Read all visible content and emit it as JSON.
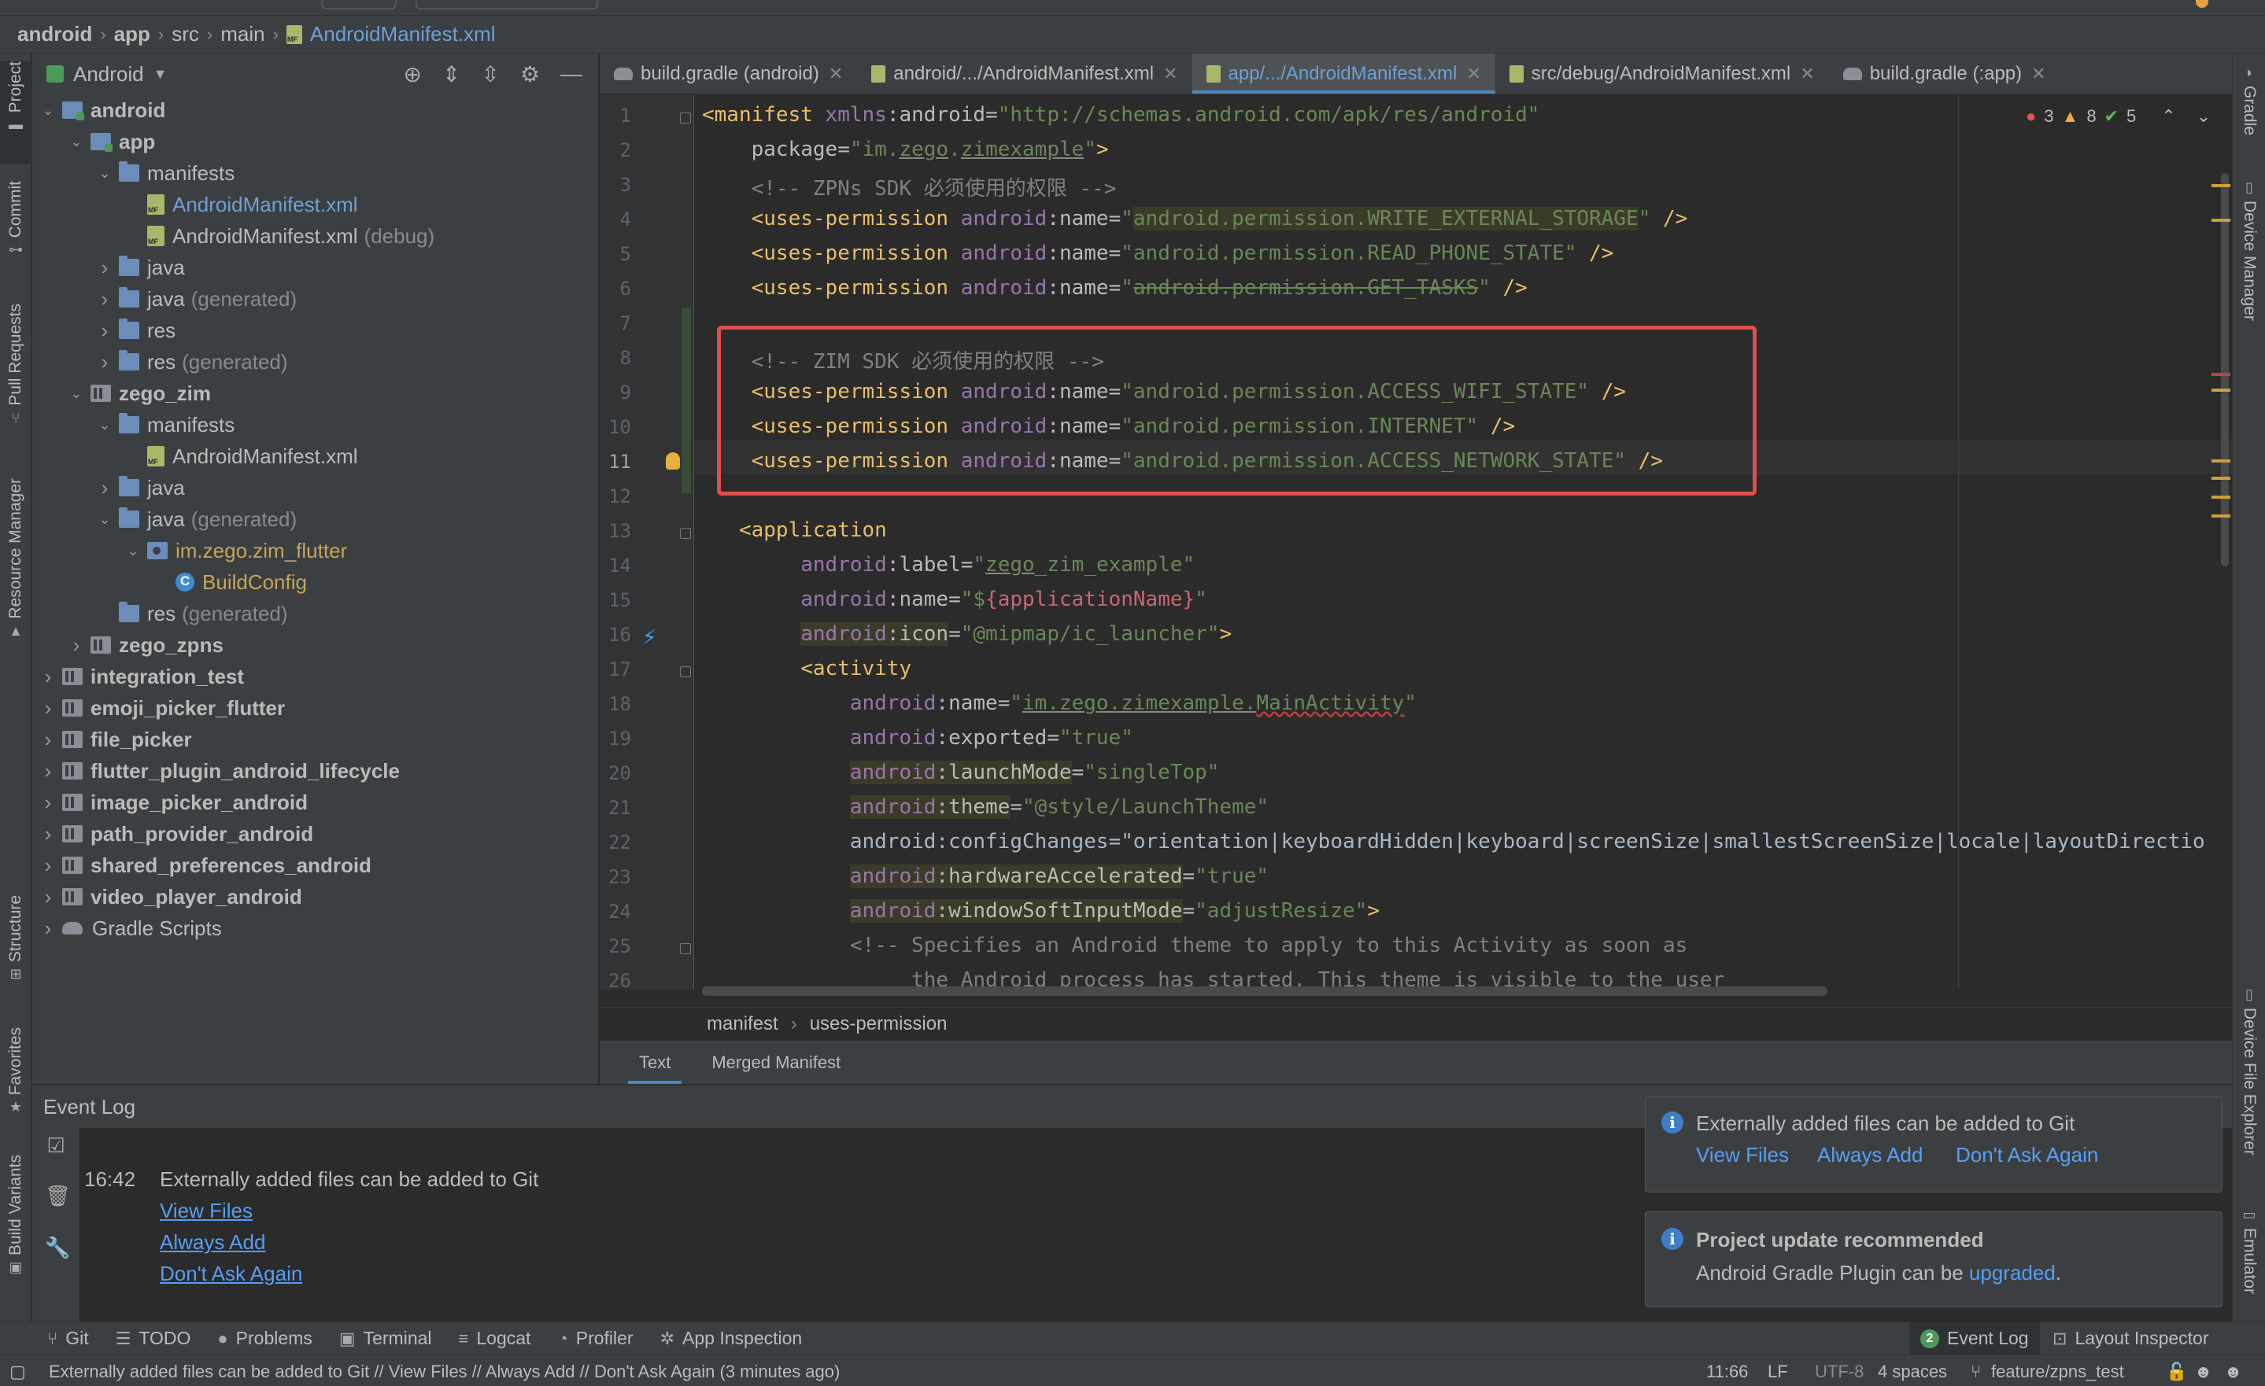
{
  "breadcrumb": [
    "android",
    "app",
    "src",
    "main",
    "AndroidManifest.xml"
  ],
  "project_panel": {
    "view_label": "Android",
    "tree": [
      {
        "label": "android",
        "suffix": "",
        "depth": 0,
        "icon": "module",
        "expanded": true,
        "bold": true
      },
      {
        "label": "app",
        "suffix": "",
        "depth": 1,
        "icon": "module",
        "expanded": true,
        "bold": true
      },
      {
        "label": "manifests",
        "suffix": "",
        "depth": 2,
        "icon": "folder",
        "expanded": true
      },
      {
        "label": "AndroidManifest.xml",
        "suffix": "",
        "depth": 3,
        "icon": "xml",
        "selected": true
      },
      {
        "label": "AndroidManifest.xml",
        "suffix": "(debug)",
        "depth": 3,
        "icon": "xml"
      },
      {
        "label": "java",
        "suffix": "",
        "depth": 2,
        "icon": "folder",
        "expanded": false
      },
      {
        "label": "java",
        "suffix": "(generated)",
        "depth": 2,
        "icon": "folder",
        "expanded": false
      },
      {
        "label": "res",
        "suffix": "",
        "depth": 2,
        "icon": "folder",
        "expanded": false
      },
      {
        "label": "res",
        "suffix": "(generated)",
        "depth": 2,
        "icon": "folder",
        "expanded": false
      },
      {
        "label": "zego_zim",
        "suffix": "",
        "depth": 1,
        "icon": "library",
        "expanded": true,
        "bold": true
      },
      {
        "label": "manifests",
        "suffix": "",
        "depth": 2,
        "icon": "folder",
        "expanded": true
      },
      {
        "label": "AndroidManifest.xml",
        "suffix": "",
        "depth": 3,
        "icon": "xml"
      },
      {
        "label": "java",
        "suffix": "",
        "depth": 2,
        "icon": "folder",
        "expanded": false
      },
      {
        "label": "java",
        "suffix": "(generated)",
        "depth": 2,
        "icon": "folder",
        "expanded": true
      },
      {
        "label": "im.zego.zim_flutter",
        "suffix": "",
        "depth": 3,
        "icon": "package",
        "expanded": true,
        "pkg": true
      },
      {
        "label": "BuildConfig",
        "suffix": "",
        "depth": 4,
        "icon": "class",
        "pkg": true
      },
      {
        "label": "res",
        "suffix": "(generated)",
        "depth": 2,
        "icon": "folder"
      },
      {
        "label": "zego_zpns",
        "suffix": "",
        "depth": 1,
        "icon": "library",
        "expanded": false,
        "bold": true
      },
      {
        "label": "integration_test",
        "suffix": "",
        "depth": 0,
        "icon": "library",
        "expanded": false,
        "bold": true
      },
      {
        "label": "emoji_picker_flutter",
        "suffix": "",
        "depth": 0,
        "icon": "library",
        "expanded": false,
        "bold": true
      },
      {
        "label": "file_picker",
        "suffix": "",
        "depth": 0,
        "icon": "library",
        "expanded": false,
        "bold": true
      },
      {
        "label": "flutter_plugin_android_lifecycle",
        "suffix": "",
        "depth": 0,
        "icon": "library",
        "expanded": false,
        "bold": true
      },
      {
        "label": "image_picker_android",
        "suffix": "",
        "depth": 0,
        "icon": "library",
        "expanded": false,
        "bold": true
      },
      {
        "label": "path_provider_android",
        "suffix": "",
        "depth": 0,
        "icon": "library",
        "expanded": false,
        "bold": true
      },
      {
        "label": "shared_preferences_android",
        "suffix": "",
        "depth": 0,
        "icon": "library",
        "expanded": false,
        "bold": true
      },
      {
        "label": "video_player_android",
        "suffix": "",
        "depth": 0,
        "icon": "library",
        "expanded": false,
        "bold": true
      },
      {
        "label": "Gradle Scripts",
        "suffix": "",
        "depth": 0,
        "icon": "gradle",
        "expanded": false
      }
    ]
  },
  "editor_tabs": [
    {
      "label": "build.gradle (android)",
      "icon": "gradle",
      "active": false
    },
    {
      "label": "android/.../AndroidManifest.xml",
      "icon": "xml",
      "active": false
    },
    {
      "label": "app/.../AndroidManifest.xml",
      "icon": "xml",
      "active": true
    },
    {
      "label": "src/debug/AndroidManifest.xml",
      "icon": "xml",
      "active": false
    },
    {
      "label": "build.gradle (:app)",
      "icon": "gradle",
      "active": false
    }
  ],
  "inspections": {
    "errors": "3",
    "warnings": "8",
    "ok": "5"
  },
  "code_lines": [
    [
      "1",
      "<manifest xmlns:android=\"http://schemas.android.com/apk/res/android\""
    ],
    [
      "2",
      "    package=\"im.zego.zimexample\">"
    ],
    [
      "3",
      "    <!-- ZPNs SDK 必须使用的权限 -->"
    ],
    [
      "4",
      "    <uses-permission android:name=\"android.permission.WRITE_EXTERNAL_STORAGE\" />"
    ],
    [
      "5",
      "    <uses-permission android:name=\"android.permission.READ_PHONE_STATE\" />"
    ],
    [
      "6",
      "    <uses-permission android:name=\"android.permission.GET_TASKS\" />"
    ],
    [
      "7",
      ""
    ],
    [
      "8",
      "    <!-- ZIM SDK 必须使用的权限 -->"
    ],
    [
      "9",
      "    <uses-permission android:name=\"android.permission.ACCESS_WIFI_STATE\" />"
    ],
    [
      "10",
      "    <uses-permission android:name=\"android.permission.INTERNET\" />"
    ],
    [
      "11",
      "    <uses-permission android:name=\"android.permission.ACCESS_NETWORK_STATE\" />"
    ],
    [
      "12",
      ""
    ],
    [
      "13",
      "   <application"
    ],
    [
      "14",
      "        android:label=\"zego_zim_example\""
    ],
    [
      "15",
      "        android:name=\"${applicationName}\""
    ],
    [
      "16",
      "        android:icon=\"@mipmap/ic_launcher\">"
    ],
    [
      "17",
      "        <activity"
    ],
    [
      "18",
      "            android:name=\"im.zego.zimexample.MainActivity\""
    ],
    [
      "19",
      "            android:exported=\"true\""
    ],
    [
      "20",
      "            android:launchMode=\"singleTop\""
    ],
    [
      "21",
      "            android:theme=\"@style/LaunchTheme\""
    ],
    [
      "22",
      "            android:configChanges=\"orientation|keyboardHidden|keyboard|screenSize|smallestScreenSize|locale|layoutDirectio"
    ],
    [
      "23",
      "            android:hardwareAccelerated=\"true\""
    ],
    [
      "24",
      "            android:windowSoftInputMode=\"adjustResize\">"
    ],
    [
      "25",
      "            <!-- Specifies an Android theme to apply to this Activity as soon as"
    ],
    [
      "26",
      "                 the Android process has started. This theme is visible to the user"
    ]
  ],
  "editor_breadcrumb": [
    "manifest",
    "uses-permission"
  ],
  "editor_bottom_tabs": [
    "Text",
    "Merged Manifest"
  ],
  "event_log": {
    "title": "Event Log",
    "time": "16:42",
    "message": "Externally added files can be added to Git",
    "links": [
      "View Files",
      "Always Add",
      "Don't Ask Again"
    ]
  },
  "notifications": [
    {
      "title": "Externally added files can be added to Git",
      "links": [
        "View Files",
        "Always Add",
        "Don't Ask Again"
      ]
    },
    {
      "title": "Project update recommended",
      "body": "Android Gradle Plugin can be",
      "link": "upgraded",
      "tail": "."
    }
  ],
  "left_stripe": [
    "Project",
    "Commit",
    "Pull Requests",
    "Resource Manager",
    "Structure",
    "Favorites",
    "Build Variants"
  ],
  "right_stripe": [
    "Gradle",
    "Device Manager",
    "Device File Explorer",
    "Emulator"
  ],
  "tool_windows": [
    "Git",
    "TODO",
    "Problems",
    "Terminal",
    "Logcat",
    "Profiler",
    "App Inspection"
  ],
  "tool_windows_right": {
    "event_log_badge": "2",
    "event_log": "Event Log",
    "layout_inspector": "Layout Inspector"
  },
  "status": {
    "message": "Externally added files can be added to Git // View Files // Always Add // Don't Ask Again (3 minutes ago)",
    "position": "11:66",
    "line_sep": "LF",
    "encoding": "UTF-8",
    "indent": "4 spaces",
    "branch": "feature/zpns_test"
  },
  "colors": {
    "accent": "#4a88c7",
    "link": "#589df6",
    "highlight_box": "#e14e4e"
  }
}
